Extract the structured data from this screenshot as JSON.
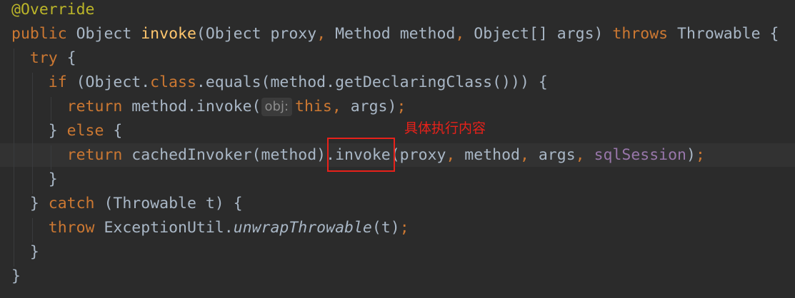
{
  "code": {
    "l1": {
      "annotation": "@Override"
    },
    "l2": {
      "kw_public": "public",
      "sp1": " Object ",
      "method_name": "invoke",
      "params": "(Object proxy",
      "c1": ",",
      "sp2": " Method method",
      "c2": ",",
      "sp3": " Object[] args) ",
      "kw_throws": "throws",
      "tail": " Throwable {"
    },
    "l3": {
      "kw_try": "try",
      "tail": " {"
    },
    "l4": {
      "kw_if": "if",
      "a": " (Object.",
      "kw_class": "class",
      "b": ".equals(method.getDeclaringClass())) {"
    },
    "l5": {
      "kw_return": "return",
      "a": " method.invoke(",
      "hint": "obj:",
      "kw_this": "this",
      "c1": ",",
      "b": " args)",
      "semi": ";"
    },
    "l6": {
      "a": "} ",
      "kw_else": "else",
      "b": " {"
    },
    "l7": {
      "kw_return": "return",
      "a": " cachedInvoker(method)",
      "invoke": ".invoke",
      "b": "(proxy",
      "c1": ",",
      "c": " method",
      "c2": ",",
      "d": " args",
      "c3": ",",
      "e": " ",
      "field": "sqlSession",
      "f": ")",
      "semi": ";"
    },
    "l8": {
      "a": "}"
    },
    "l9": {
      "a": "} ",
      "kw_catch": "catch",
      "b": " (Throwable t) {"
    },
    "l10": {
      "kw_throw": "throw",
      "a": " ExceptionUtil.",
      "static_call": "unwrapThrowable",
      "b": "(t)",
      "semi": ";"
    },
    "l11": {
      "a": "}"
    },
    "l12": {
      "a": "}"
    }
  },
  "annotation_note": {
    "text": "具体执行内容",
    "color": "#e8211a"
  },
  "colors": {
    "background": "#2b2b2b",
    "text": "#a9b7c6",
    "keyword": "#cc7832",
    "annotation": "#bbb529",
    "method_decl": "#ffc66d",
    "field": "#9876aa",
    "highlight_box": "#e8211a"
  }
}
